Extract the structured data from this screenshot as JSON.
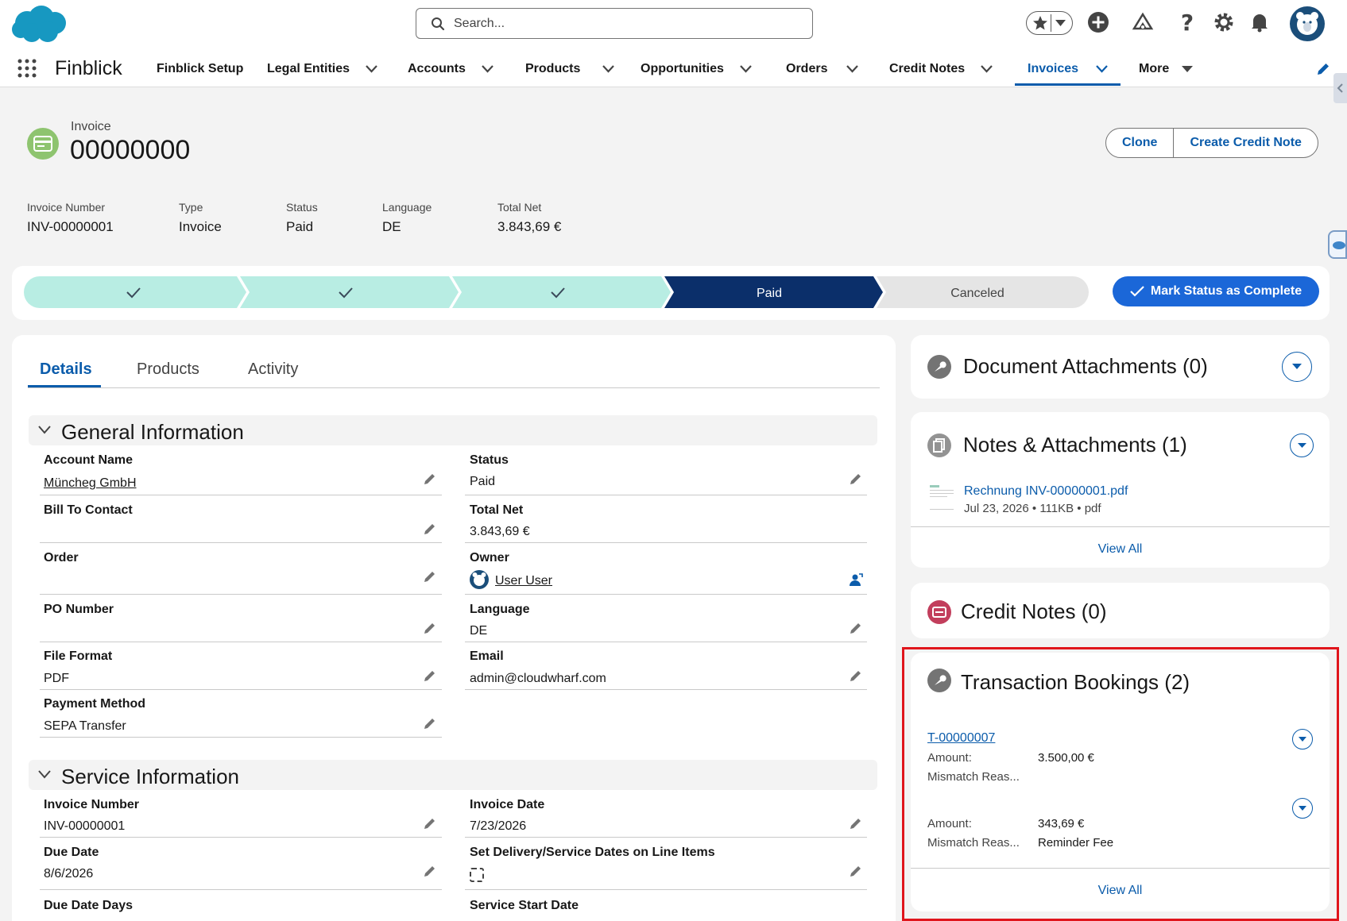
{
  "header": {
    "search_placeholder": "Search...",
    "app_name": "Finblick",
    "nav": [
      {
        "label": "Finblick Setup",
        "dropdown": false
      },
      {
        "label": "Legal Entities",
        "dropdown": true
      },
      {
        "label": "Accounts",
        "dropdown": true
      },
      {
        "label": "Products",
        "dropdown": true
      },
      {
        "label": "Opportunities",
        "dropdown": true
      },
      {
        "label": "Orders",
        "dropdown": true
      },
      {
        "label": "Credit Notes",
        "dropdown": true
      },
      {
        "label": "Invoices",
        "dropdown": true,
        "active": true
      },
      {
        "label": "More",
        "dropdown": true
      }
    ]
  },
  "record": {
    "object_label": "Invoice",
    "title": "00000000",
    "buttons": {
      "clone": "Clone",
      "create_credit_note": "Create Credit Note"
    },
    "highlights": [
      {
        "label": "Invoice Number",
        "value": "INV-00000001"
      },
      {
        "label": "Type",
        "value": "Invoice"
      },
      {
        "label": "Status",
        "value": "Paid"
      },
      {
        "label": "Language",
        "value": "DE"
      },
      {
        "label": "Total Net",
        "value": "3.843,69 €"
      }
    ]
  },
  "path": {
    "stages": [
      {
        "label": "",
        "state": "complete"
      },
      {
        "label": "",
        "state": "complete"
      },
      {
        "label": "",
        "state": "complete"
      },
      {
        "label": "Paid",
        "state": "current"
      },
      {
        "label": "Canceled",
        "state": "incomplete"
      }
    ],
    "mark_button": "Mark Status as Complete"
  },
  "tabs": {
    "details": "Details",
    "products": "Products",
    "activity": "Activity"
  },
  "general": {
    "title": "General Information",
    "account_name_label": "Account Name",
    "account_name": "Müncheg GmbH",
    "status_label": "Status",
    "status": "Paid",
    "bill_to_label": "Bill To Contact",
    "total_net_label": "Total Net",
    "total_net": "3.843,69 €",
    "order_label": "Order",
    "owner_label": "Owner",
    "owner": "User User",
    "po_label": "PO Number",
    "language_label": "Language",
    "language": "DE",
    "file_format_label": "File Format",
    "file_format": "PDF",
    "email_label": "Email",
    "email": "admin@cloudwharf.com",
    "payment_label": "Payment Method",
    "payment": "SEPA Transfer"
  },
  "service": {
    "title": "Service Information",
    "invoice_number_label": "Invoice Number",
    "invoice_number": "INV-00000001",
    "invoice_date_label": "Invoice Date",
    "invoice_date": "7/23/2026",
    "due_date_label": "Due Date",
    "due_date": "8/6/2026",
    "set_delivery_label": "Set Delivery/Service Dates on Line Items",
    "set_delivery_checked": false,
    "due_days_label": "Due Date Days",
    "service_start_label": "Service Start Date"
  },
  "doc_attachments": {
    "title": "Document Attachments (0)"
  },
  "notes": {
    "title": "Notes & Attachments (1)",
    "file_name": "Rechnung INV-00000001.pdf",
    "file_meta": "Jul 23, 2026 • 111KB • pdf",
    "view_all": "View All"
  },
  "credit_notes": {
    "title": "Credit Notes (0)"
  },
  "transactions": {
    "title": "Transaction Bookings (2)",
    "items": [
      {
        "name": "T-00000007",
        "amount_label": "Amount:",
        "amount": "3.500,00 €",
        "reason_label": "Mismatch Reas...",
        "reason": ""
      },
      {
        "name": "",
        "amount_label": "Amount:",
        "amount": "343,69 €",
        "reason_label": "Mismatch Reas...",
        "reason": "Reminder Fee"
      }
    ],
    "view_all": "View All"
  },
  "colors": {
    "brand": "#0b5cab",
    "path_complete": "#b8ede3",
    "path_current": "#0b2f6a",
    "highlight": "#e0151c"
  }
}
